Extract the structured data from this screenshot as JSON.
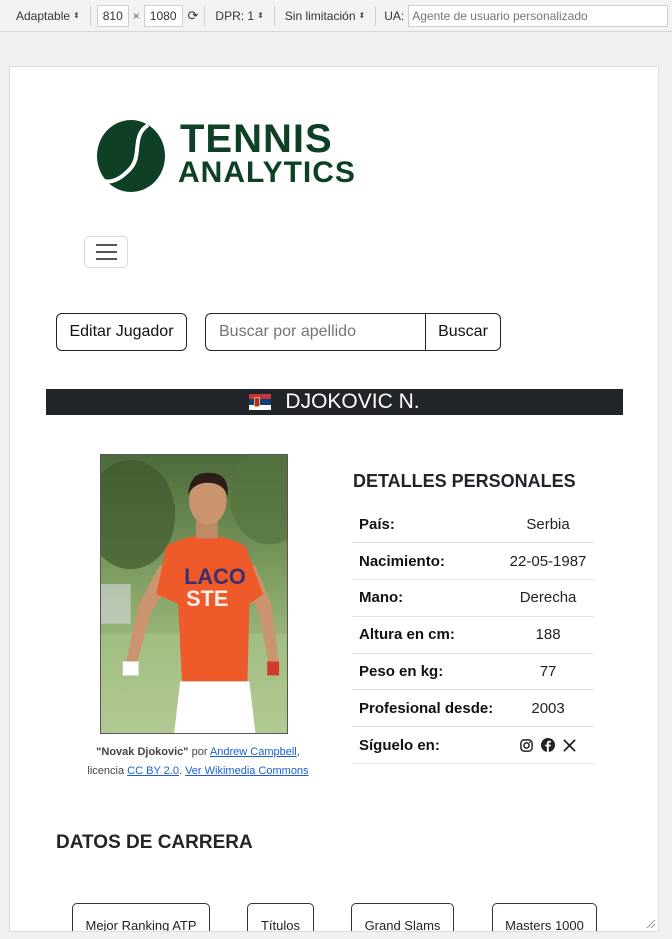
{
  "devtools": {
    "mode": "Adaptable",
    "width": "810",
    "times": "×",
    "height": "1080",
    "dpr": "DPR: 1",
    "throttle": "Sin limitación",
    "ua_label": "UA:",
    "ua_placeholder": "Agente de usuario personalizado"
  },
  "logo": {
    "line1": "TENNIS",
    "line2": "ANALYTICS",
    "color": "#0d4025"
  },
  "toolbar": {
    "edit_label": "Editar Jugador",
    "search_placeholder": "Buscar por apellido",
    "search_label": "Buscar"
  },
  "player": {
    "name": "DJOKOVIC N.",
    "flag": "serbia-flag-icon"
  },
  "photo_caption": {
    "title": "\"Novak Djokovic\"",
    "by": "por",
    "author": "Andrew Campbell",
    "comma": ",",
    "license_word": "licencia",
    "license": "CC BY 2.0",
    "dot": ".",
    "wikimedia": "Ver Wikimedia Commons"
  },
  "details": {
    "title": "DETALLES PERSONALES",
    "rows": [
      {
        "label": "País:",
        "value": "Serbia"
      },
      {
        "label": "Nacimiento:",
        "value": "22-05-1987"
      },
      {
        "label": "Mano:",
        "value": "Derecha"
      },
      {
        "label": "Altura en cm:",
        "value": "188"
      },
      {
        "label": "Peso en kg:",
        "value": "77"
      },
      {
        "label": "Profesional desde:",
        "value": "2003"
      }
    ],
    "follow_label": "Síguelo en:",
    "social_icons": [
      "instagram-icon",
      "facebook-icon",
      "x-icon"
    ]
  },
  "career": {
    "title": "DATOS DE CARRERA",
    "buttons": [
      "Mejor Ranking ATP",
      "Títulos",
      "Grand Slams",
      "Masters 1000"
    ]
  }
}
